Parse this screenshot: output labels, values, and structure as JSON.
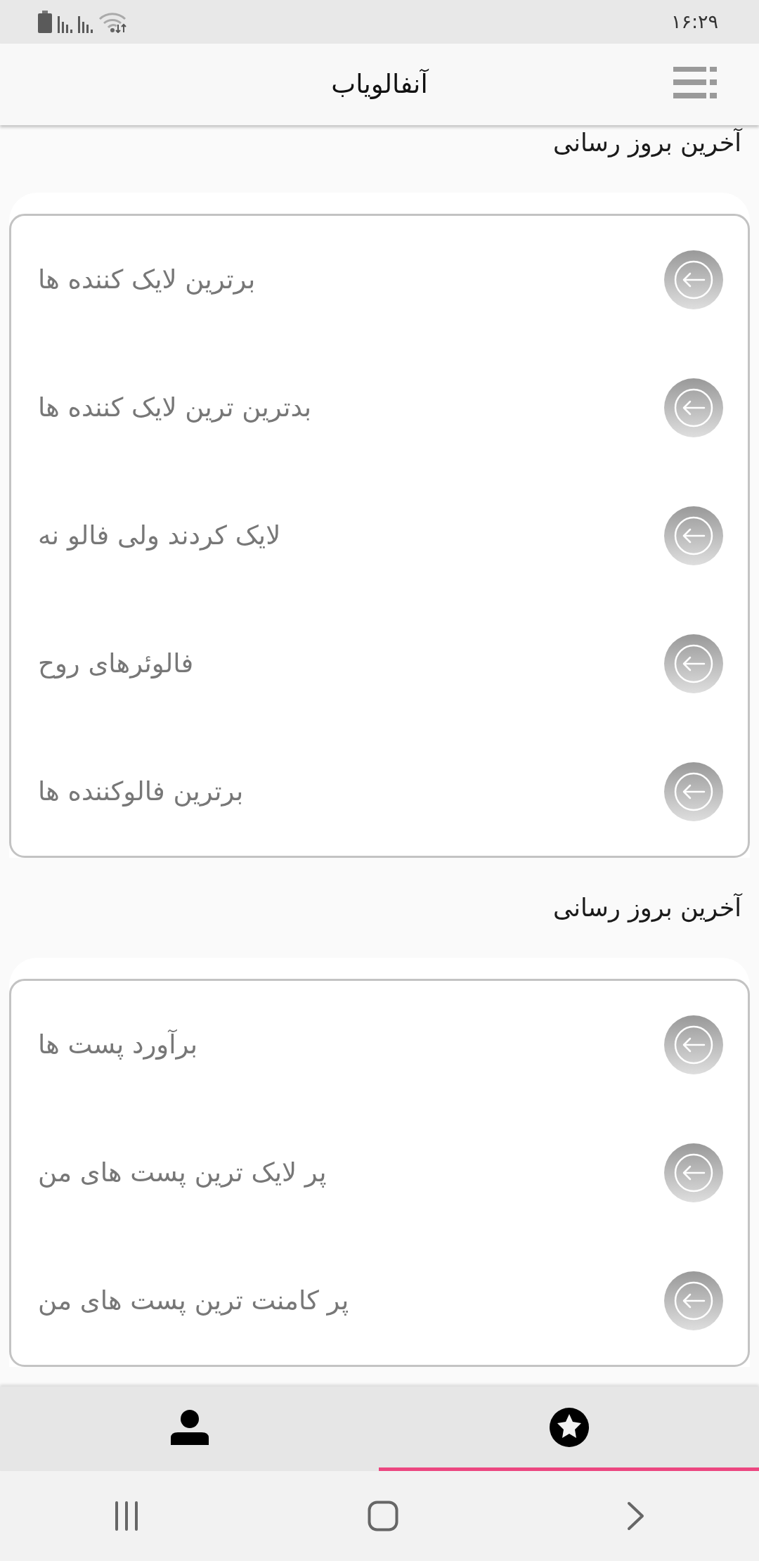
{
  "status_bar": {
    "time": "۱۶:۲۹"
  },
  "app_bar": {
    "title": "آنفالویاب"
  },
  "sections": [
    {
      "heading": "آخرین بروز رسانی",
      "items": [
        {
          "label": "برترین لایک کننده ها"
        },
        {
          "label": "بدترین ترین لایک کننده ها"
        },
        {
          "label": "لایک کردند ولی فالو نه"
        },
        {
          "label": "فالوئرهای روح"
        },
        {
          "label": "برترین فالوکننده ها"
        }
      ]
    },
    {
      "heading": "آخرین بروز رسانی",
      "items": [
        {
          "label": "برآورد پست ها"
        },
        {
          "label": "پر لایک ترین پست های من"
        },
        {
          "label": "پر کامنت ترین پست های من"
        }
      ]
    }
  ],
  "bottom_nav": [
    {
      "kind": "person",
      "selected": false
    },
    {
      "kind": "star",
      "selected": true
    }
  ]
}
